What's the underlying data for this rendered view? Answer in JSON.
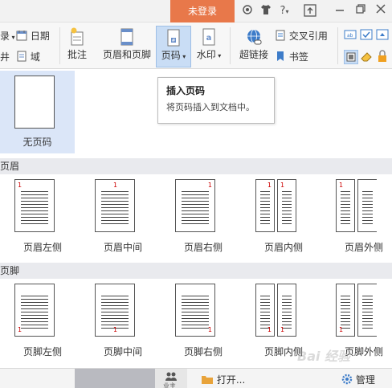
{
  "titlebar": {
    "login_label": "未登录",
    "icons": [
      "skin-icon",
      "tshirt-icon",
      "help-icon",
      "upload-icon",
      "minimize-icon",
      "restore-icon",
      "close-icon"
    ],
    "help_label": "?"
  },
  "ribbon": {
    "left_top_partial": "录",
    "left_bottom_partial": "井",
    "date_label": "日期",
    "field_label": "域",
    "comment_label": "批注",
    "header_footer_label": "页眉和页脚",
    "page_number_label": "页码",
    "watermark_label": "水印",
    "hyperlink_label": "超链接",
    "crossref_label": "交叉引用",
    "bookmark_label": "书签"
  },
  "gallery": {
    "none_label": "无页码",
    "header_section": "页眉",
    "footer_section": "页脚",
    "header_items": [
      "页眉左侧",
      "页眉中间",
      "页眉右侧",
      "页眉内侧",
      "页眉外侧"
    ],
    "footer_items": [
      "页脚左侧",
      "页脚中间",
      "页脚右侧",
      "页脚内侧",
      "页脚外侧"
    ],
    "page_number_digit": "1"
  },
  "tooltip": {
    "title": "插入页码",
    "desc": "将页码插入到文档中。"
  },
  "bottom": {
    "open_label": "打开...",
    "manage_label": "管理",
    "left_partial": "业主"
  },
  "watermark_text": "Bai 经验",
  "colors": {
    "login_bg": "#e8784a",
    "active_button": "#c9ddf5",
    "selected_cell": "#dbe6f8",
    "page_number": "#cc0000"
  }
}
